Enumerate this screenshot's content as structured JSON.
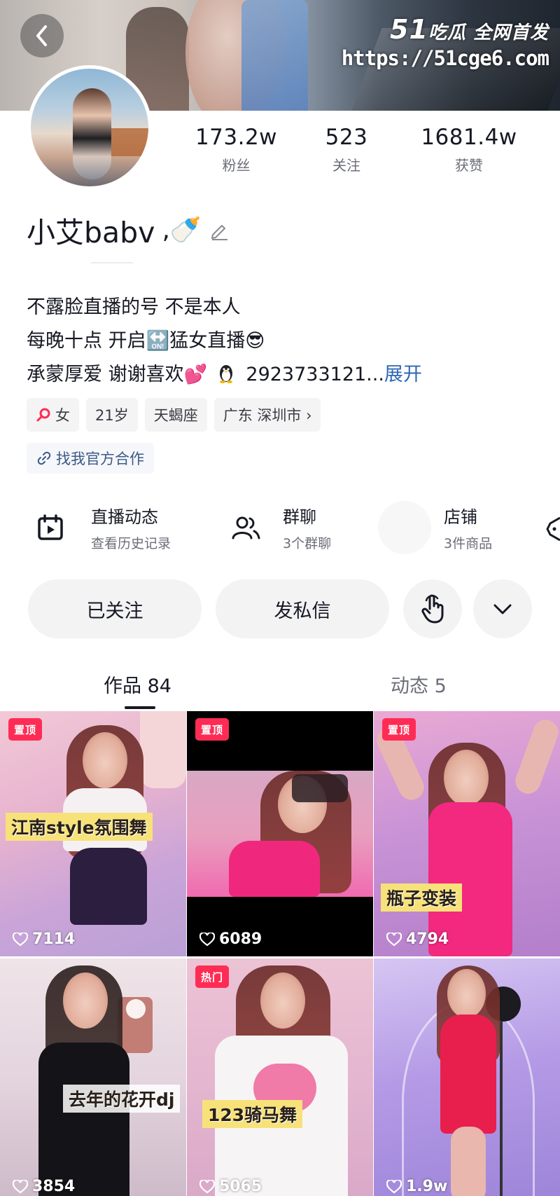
{
  "banner": {
    "watermark_brand": "51",
    "watermark_suffix": "吃瓜 全网首发",
    "watermark_url": "https://51cge6.com"
  },
  "profile": {
    "name": "小艾babv",
    "name_emoji": ",🍼",
    "stats": [
      {
        "value": "173.2w",
        "label": "粉丝"
      },
      {
        "value": "523",
        "label": "关注"
      },
      {
        "value": "1681.4w",
        "label": "获赞"
      }
    ],
    "bio_lines": [
      "不露脸直播的号 不是本人",
      "每晚十点 开启🔛猛女直播😎",
      "承蒙厚爱 谢谢喜欢💕"
    ],
    "qq_number": "2923733121...",
    "bio_more": "展开",
    "tags": [
      {
        "icon": "female-icon",
        "label": "女"
      },
      {
        "label": "21岁"
      },
      {
        "label": "天蝎座"
      },
      {
        "label": "广东 深圳市 ›"
      }
    ],
    "cooperation": "找我官方合作"
  },
  "features": [
    {
      "icon": "live-calendar-icon",
      "title": "直播动态",
      "subtitle": "查看历史记录"
    },
    {
      "icon": "group-chat-icon",
      "title": "群聊",
      "subtitle": "3个群聊"
    },
    {
      "icon": "shop-icon",
      "title": "店铺",
      "subtitle": "3件商品"
    }
  ],
  "actions": {
    "followed": "已关注",
    "message": "发私信"
  },
  "tabs": [
    {
      "label": "作品 84",
      "active": true
    },
    {
      "label": "动态 5",
      "active": false
    }
  ],
  "videos": [
    {
      "badge": "置顶",
      "caption": "江南style氛围舞",
      "likes": "7114"
    },
    {
      "badge": "置顶",
      "caption": "",
      "likes": "6089"
    },
    {
      "badge": "置顶",
      "caption": "瓶子变装",
      "likes": "4794"
    },
    {
      "badge": "",
      "caption": "去年的花开dj",
      "likes": "3854"
    },
    {
      "badge": "热门",
      "caption": "123骑马舞",
      "likes": "5065"
    },
    {
      "badge": "",
      "caption": "",
      "likes": "1.9w"
    }
  ],
  "colors": {
    "accent": "#fe2c55",
    "link": "#2e66b7",
    "text": "#161823",
    "muted": "#6b6e78"
  }
}
